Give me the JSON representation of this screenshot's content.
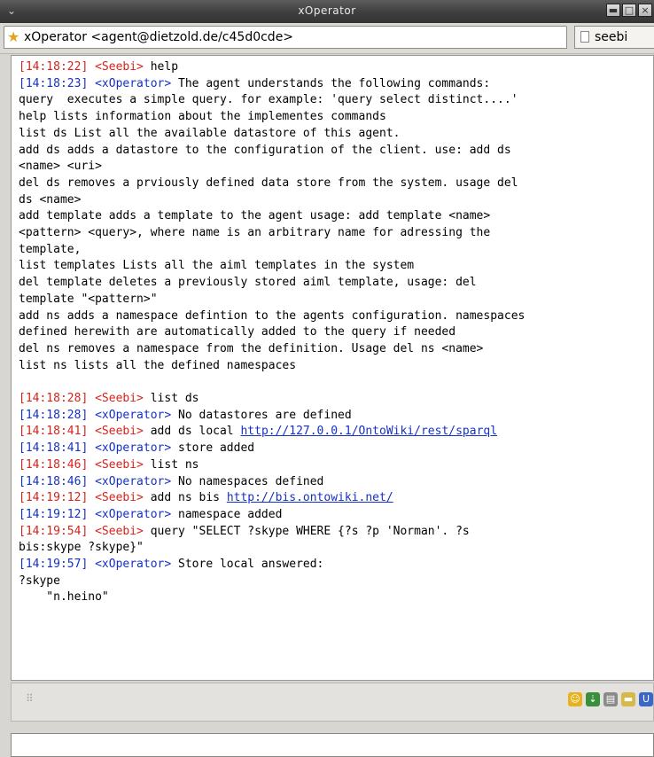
{
  "window": {
    "title": "xOperator",
    "controls": [
      {
        "name": "minimize-button",
        "glyph": "▬"
      },
      {
        "name": "maximize-button",
        "glyph": "□"
      },
      {
        "name": "close-button",
        "glyph": "×"
      }
    ]
  },
  "tabs": [
    {
      "label": "xOperator <agent@dietzold.de/c45d0cde>",
      "icon": "star-icon",
      "active": true
    },
    {
      "label": "seebi",
      "icon": "document-icon",
      "active": false
    }
  ],
  "log": [
    [
      [
        "red",
        "[14:18:22] <Seebi>"
      ],
      [
        "black",
        " help"
      ]
    ],
    [
      [
        "blue",
        "[14:18:23] <xOperator>"
      ],
      [
        "black",
        " The agent understands the following commands:"
      ]
    ],
    [
      [
        "black",
        "query  executes a simple query. for example: 'query select distinct....'"
      ]
    ],
    [
      [
        "black",
        "help lists information about the implementes commands"
      ]
    ],
    [
      [
        "black",
        "list ds List all the available datastore of this agent."
      ]
    ],
    [
      [
        "black",
        "add ds adds a datastore to the configuration of the client. use: add ds"
      ]
    ],
    [
      [
        "black",
        "<name> <uri>"
      ]
    ],
    [
      [
        "black",
        "del ds removes a prviously defined data store from the system. usage del"
      ]
    ],
    [
      [
        "black",
        "ds <name>"
      ]
    ],
    [
      [
        "black",
        "add template adds a template to the agent usage: add template <name>"
      ]
    ],
    [
      [
        "black",
        "<pattern> <query>, where name is an arbitrary name for adressing the"
      ]
    ],
    [
      [
        "black",
        "template,"
      ]
    ],
    [
      [
        "black",
        "list templates Lists all the aiml templates in the system"
      ]
    ],
    [
      [
        "black",
        "del template deletes a previously stored aiml template, usage: del"
      ]
    ],
    [
      [
        "black",
        "template \"<pattern>\""
      ]
    ],
    [
      [
        "black",
        "add ns adds a namespace defintion to the agents configuration. namespaces"
      ]
    ],
    [
      [
        "black",
        "defined herewith are automatically added to the query if needed"
      ]
    ],
    [
      [
        "black",
        "del ns removes a namespace from the definition. Usage del ns <name>"
      ]
    ],
    [
      [
        "black",
        "list ns lists all the defined namespaces"
      ]
    ],
    [],
    [
      [
        "red",
        "[14:18:28] <Seebi>"
      ],
      [
        "black",
        " list ds"
      ]
    ],
    [
      [
        "blue",
        "[14:18:28] <xOperator>"
      ],
      [
        "black",
        " No datastores are defined"
      ]
    ],
    [
      [
        "red",
        "[14:18:41] <Seebi>"
      ],
      [
        "black",
        " add ds local "
      ],
      [
        "link",
        "http://127.0.0.1/OntoWiki/rest/sparql"
      ]
    ],
    [
      [
        "blue",
        "[14:18:41] <xOperator>"
      ],
      [
        "black",
        " store added"
      ]
    ],
    [
      [
        "red",
        "[14:18:46] <Seebi>"
      ],
      [
        "black",
        " list ns"
      ]
    ],
    [
      [
        "blue",
        "[14:18:46] <xOperator>"
      ],
      [
        "black",
        " No namespaces defined"
      ]
    ],
    [
      [
        "red",
        "[14:19:12] <Seebi>"
      ],
      [
        "black",
        " add ns bis "
      ],
      [
        "link",
        "http://bis.ontowiki.net/"
      ]
    ],
    [
      [
        "blue",
        "[14:19:12] <xOperator>"
      ],
      [
        "black",
        " namespace added"
      ]
    ],
    [
      [
        "red",
        "[14:19:54] <Seebi>"
      ],
      [
        "black",
        " query \"SELECT ?skype WHERE {?s ?p 'Norman'. ?s"
      ]
    ],
    [
      [
        "black",
        "bis:skype ?skype}\""
      ]
    ],
    [
      [
        "blue",
        "[14:19:57] <xOperator>"
      ],
      [
        "black",
        " Store local answered:"
      ]
    ],
    [
      [
        "black",
        "?skype"
      ]
    ],
    [
      [
        "black",
        "    \"n.heino\""
      ]
    ]
  ],
  "toolbar_icons": [
    {
      "name": "smiley-icon",
      "glyph": "☺",
      "color": "#e8b21c"
    },
    {
      "name": "user-transfer-icon",
      "glyph": "⇣",
      "color": "#3a8f3a"
    },
    {
      "name": "print-icon",
      "glyph": "▤",
      "color": "#8a8a8a"
    },
    {
      "name": "note-icon",
      "glyph": "▬",
      "color": "#d9b84a"
    },
    {
      "name": "underline-icon",
      "glyph": "U",
      "color": "#3b67c8"
    }
  ],
  "message_input": {
    "value": ""
  }
}
